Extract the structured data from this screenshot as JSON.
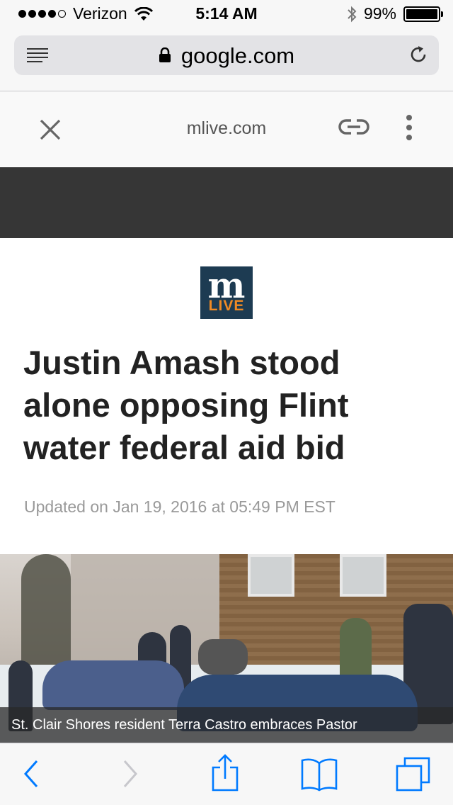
{
  "status_bar": {
    "carrier": "Verizon",
    "signal_bars": 4,
    "time": "5:14 AM",
    "battery": "99%",
    "battery_level": 0.99
  },
  "url_bar": {
    "url": "google.com"
  },
  "amp_header": {
    "domain": "mlive.com"
  },
  "logo": {
    "top": "m",
    "bottom": "LIVE"
  },
  "article": {
    "headline": "Justin Amash stood alone opposing Flint water federal aid bid",
    "updated": "Updated on Jan 19, 2016 at 05:49 PM EST",
    "photo_caption": "St. Clair Shores resident Terra Castro embraces Pastor"
  },
  "colors": {
    "logo_bg": "#1d3b52",
    "logo_live": "#f08a24",
    "ios_blue": "#007aff",
    "dark_bar": "#363636"
  },
  "icons": [
    "reader-list-icon",
    "lock-icon",
    "reload-icon",
    "close-icon",
    "link-icon",
    "more-vertical-icon",
    "back-chevron-icon",
    "forward-chevron-icon",
    "share-icon",
    "bookmarks-icon",
    "tabs-icon"
  ]
}
